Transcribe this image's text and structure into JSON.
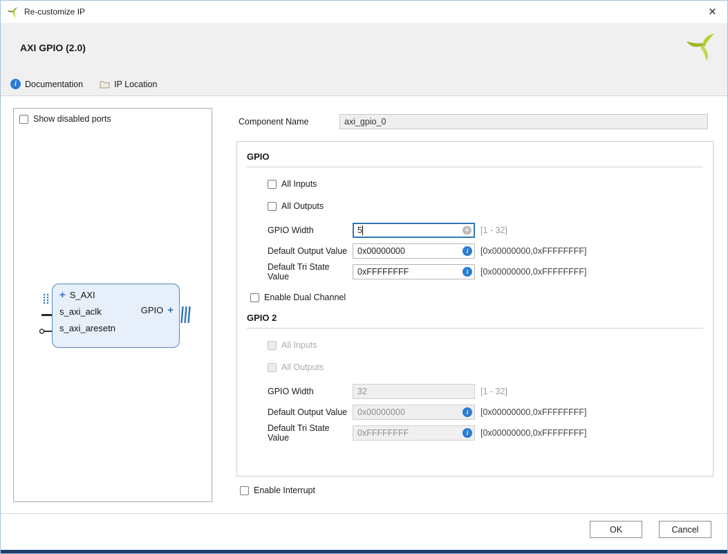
{
  "window": {
    "title": "Re-customize IP",
    "close_glyph": "×"
  },
  "header": {
    "title": "AXI GPIO (2.0)"
  },
  "toolbar": {
    "documentation": "Documentation",
    "ip_location": "IP Location"
  },
  "ports_panel": {
    "show_disabled_ports": "Show disabled ports",
    "block": {
      "s_axi": "S_AXI",
      "clk": "s_axi_aclk",
      "resetn": "s_axi_aresetn",
      "gpio": "GPIO"
    }
  },
  "component": {
    "label": "Component Name",
    "value": "axi_gpio_0"
  },
  "gpio": {
    "title": "GPIO",
    "all_inputs": "All Inputs",
    "all_outputs": "All Outputs",
    "width_label": "GPIO Width",
    "width_value": "5",
    "width_hint": "[1 - 32]",
    "default_output_label": "Default Output Value",
    "default_output_value": "0x00000000",
    "default_output_hint": "[0x00000000,0xFFFFFFFF]",
    "tri_state_label": "Default Tri State Value",
    "tri_state_value": "0xFFFFFFFF",
    "tri_state_hint": "[0x00000000,0xFFFFFFFF]"
  },
  "dual_channel_label": "Enable Dual Channel",
  "gpio2": {
    "title": "GPIO 2",
    "all_inputs": "All Inputs",
    "all_outputs": "All Outputs",
    "width_label": "GPIO Width",
    "width_value": "32",
    "width_hint": "[1 - 32]",
    "default_output_label": "Default Output Value",
    "default_output_value": "0x00000000",
    "default_output_hint": "[0x00000000,0xFFFFFFFF]",
    "tri_state_label": "Default Tri State Value",
    "tri_state_value": "0xFFFFFFFF",
    "tri_state_hint": "[0x00000000,0xFFFFFFFF]"
  },
  "interrupt_label": "Enable Interrupt",
  "buttons": {
    "ok": "OK",
    "cancel": "Cancel"
  },
  "icons": {
    "info_glyph": "i",
    "clear_glyph": "×",
    "plus_glyph": "+"
  },
  "colors": {
    "focus_blue": "#2e75b6",
    "info_blue": "#2b7cd3",
    "block_fill": "#e6effa",
    "block_border": "#5585bd",
    "header_gray": "#f0f0f0",
    "bottom_bar_navy": "#1d3f6e",
    "hint_gray": "#9e9e9e"
  }
}
